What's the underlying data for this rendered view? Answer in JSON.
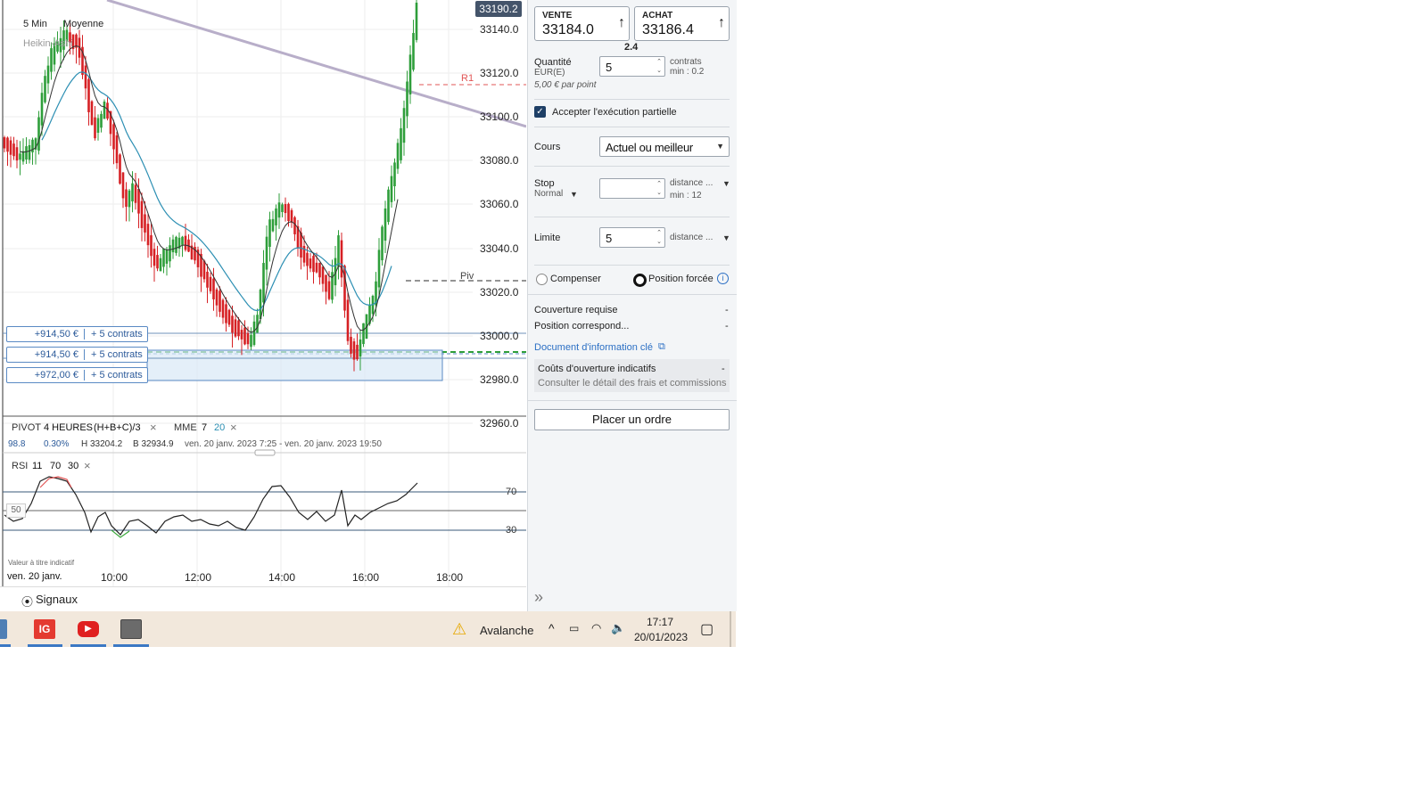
{
  "chart": {
    "timeframe": "5 Min",
    "average_label": "Moyenne",
    "style_label": "Heikin-Ashi",
    "current_price": "33190.2",
    "price_axis": [
      "33140.0",
      "33120.0",
      "33100.0",
      "33080.0",
      "33060.0",
      "33040.0",
      "33020.0",
      "33000.0",
      "32980.0",
      "32960.0"
    ],
    "time_axis": [
      "10:00",
      "12:00",
      "14:00",
      "16:00",
      "18:00"
    ],
    "date_label": "ven. 20 janv.",
    "r1_label": "R1",
    "piv_label": "Piv",
    "positions": [
      {
        "pnl": "+914,50 €",
        "qty": "+ 5 contrats"
      },
      {
        "pnl": "+914,50 €",
        "qty": "+ 5 contrats"
      },
      {
        "pnl": "+972,00 €",
        "qty": "+ 5 contrats"
      }
    ],
    "indicator_bar": {
      "pivot": "PIVOT",
      "pivot_period": "4 HEURES",
      "pivot_formula": "(H+B+C)/3",
      "mme": "MME",
      "mme_p1": "7",
      "mme_p2": "20",
      "close_icon": "×"
    },
    "info_row": {
      "change": "98.8",
      "change_pct": "0.30%",
      "high": "H 33204.2",
      "low": "B 32934.9",
      "range": "ven. 20 janv. 2023 7:25 - ven. 20 janv. 2023 19:50"
    },
    "rsi": {
      "name": "RSI",
      "p1": "11",
      "p2": "70",
      "p3": "30",
      "lvl70": "70",
      "lvl50": "50",
      "lvl30": "30"
    },
    "disclaimer": "Valeur à titre indicatif",
    "signals_label": "Signaux",
    "colors": {
      "up": "#2e9e3a",
      "down": "#d62024",
      "ema_fast": "#333333",
      "ema_slow": "#2c8fb3",
      "r1": "#e05555",
      "pivot": "#555555",
      "trendline": "#b8aec9",
      "position": "#5a8ac4"
    }
  },
  "panel": {
    "sell_label": "VENTE",
    "sell_price": "33184.0",
    "buy_label": "ACHAT",
    "buy_price": "33186.4",
    "spread": "2.4",
    "quantity_label": "Quantité",
    "currency_label": "EUR(E)",
    "quantity_value": "5",
    "contracts_label": "contrats",
    "min_qty": "min : 0.2",
    "per_point": "5,00 € par point",
    "partial_exec_label": "Accepter l'exécution partielle",
    "price_label": "Cours",
    "price_option": "Actuel ou meilleur",
    "stop_label": "Stop",
    "stop_type": "Normal",
    "stop_distance": "distance ...",
    "stop_min": "min : 12",
    "limit_label": "Limite",
    "limit_value": "5",
    "limit_distance": "distance ...",
    "compensate_label": "Compenser",
    "forced_position_label": "Position forcée",
    "margin_label": "Couverture requise",
    "margin_value": "-",
    "match_label": "Position correspond...",
    "match_value": "-",
    "kid_link": "Document d'information clé",
    "costs_label": "Coûts d'ouverture indicatifs",
    "costs_value": "-",
    "costs_detail": "Consulter le détail des frais et commissions",
    "place_order": "Placer un ordre"
  },
  "taskbar": {
    "app_ig": "IG",
    "notification": "Avalanche",
    "time": "17:17",
    "date": "20/01/2023"
  }
}
